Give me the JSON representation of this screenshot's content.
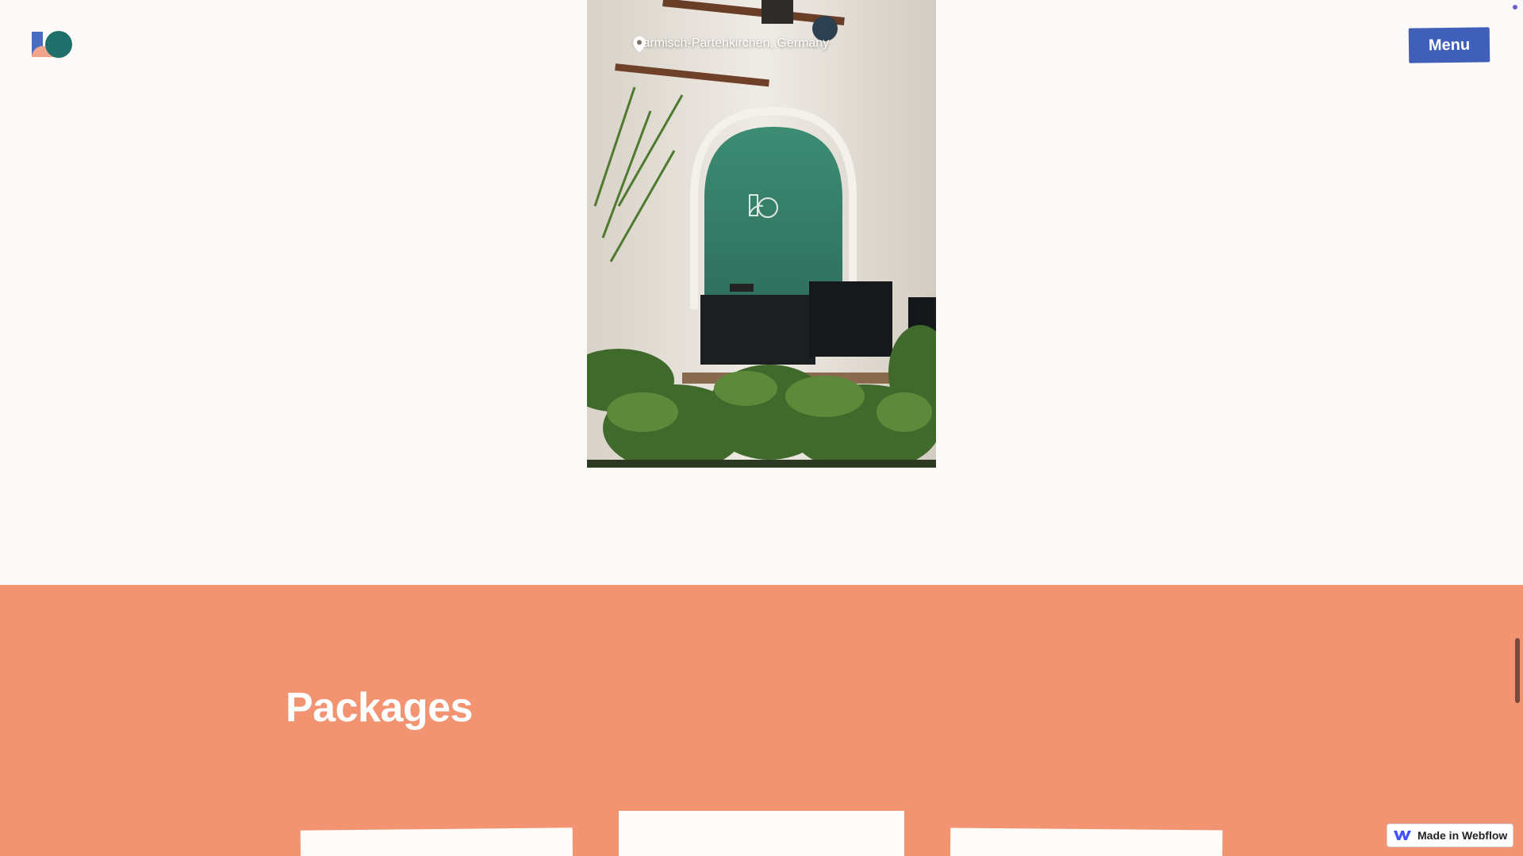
{
  "header": {
    "logo_alt": "logo",
    "menu_label": "Menu"
  },
  "photo": {
    "location": "Garmisch-Partenkirchen, Germany"
  },
  "packages": {
    "title": "Packages"
  },
  "badge": {
    "label": "Made in Webflow"
  },
  "colors": {
    "background": "#fcfaf8",
    "accent_blue": "#3f5fb8",
    "section_coral": "#f29472",
    "logo_teal": "#1f6f6a",
    "logo_blue": "#4a6cc0",
    "logo_peach": "#f1a58c"
  },
  "icons": {
    "location": "map-pin-icon",
    "badge": "webflow-logo-icon"
  }
}
